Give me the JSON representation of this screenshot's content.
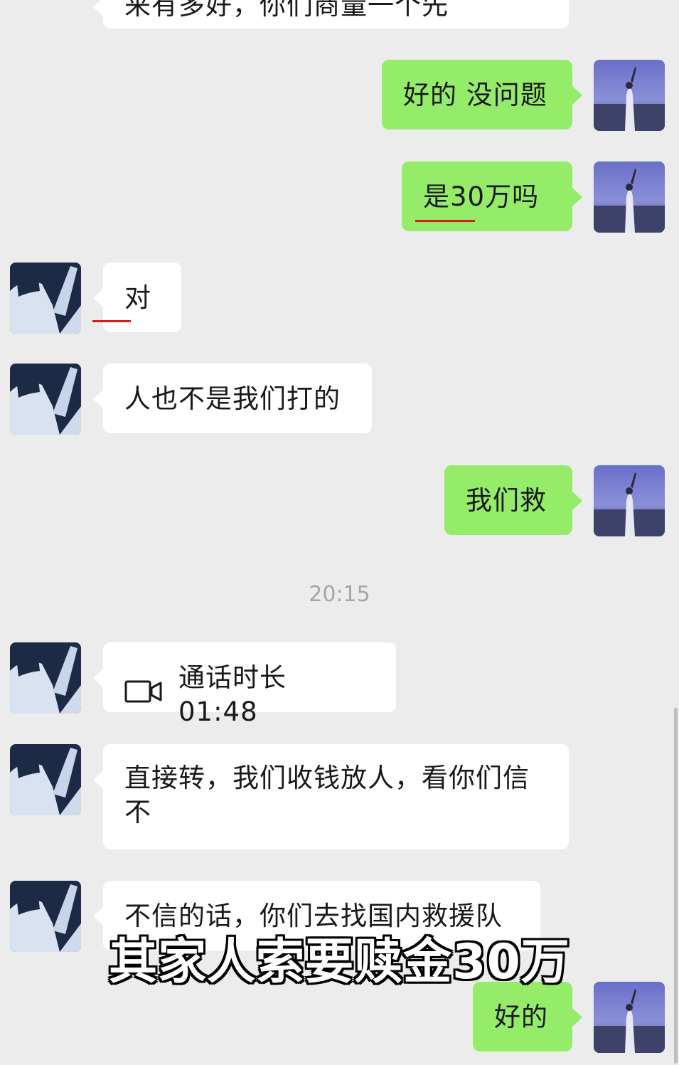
{
  "messages": [
    {
      "side": "left",
      "text": "来有多好，你们商量一个先",
      "partial": true
    },
    {
      "side": "right",
      "text": "好的 没问题"
    },
    {
      "side": "right",
      "text": "是30万吗"
    },
    {
      "side": "left",
      "text": "对"
    },
    {
      "side": "left",
      "text": "人也不是我们打的"
    },
    {
      "side": "right",
      "text": "我们救"
    },
    {
      "side": "left",
      "text": "通话时长 01:48",
      "type": "video-call"
    },
    {
      "side": "left",
      "text": "直接转，我们收钱放人，看你们信不"
    },
    {
      "side": "left",
      "text": "不信的话，你们去找国内救援队"
    },
    {
      "side": "right",
      "text": "好的"
    }
  ],
  "timestamp": "20:15",
  "subtitle": "其家人索要赎金30万",
  "colors": {
    "background": "#ececec",
    "green_bubble": "#95ec69",
    "white_bubble": "#ffffff",
    "timestamp": "#a6a6a6",
    "underline": "#d12020"
  },
  "icons": {
    "call": "video-call-icon"
  }
}
